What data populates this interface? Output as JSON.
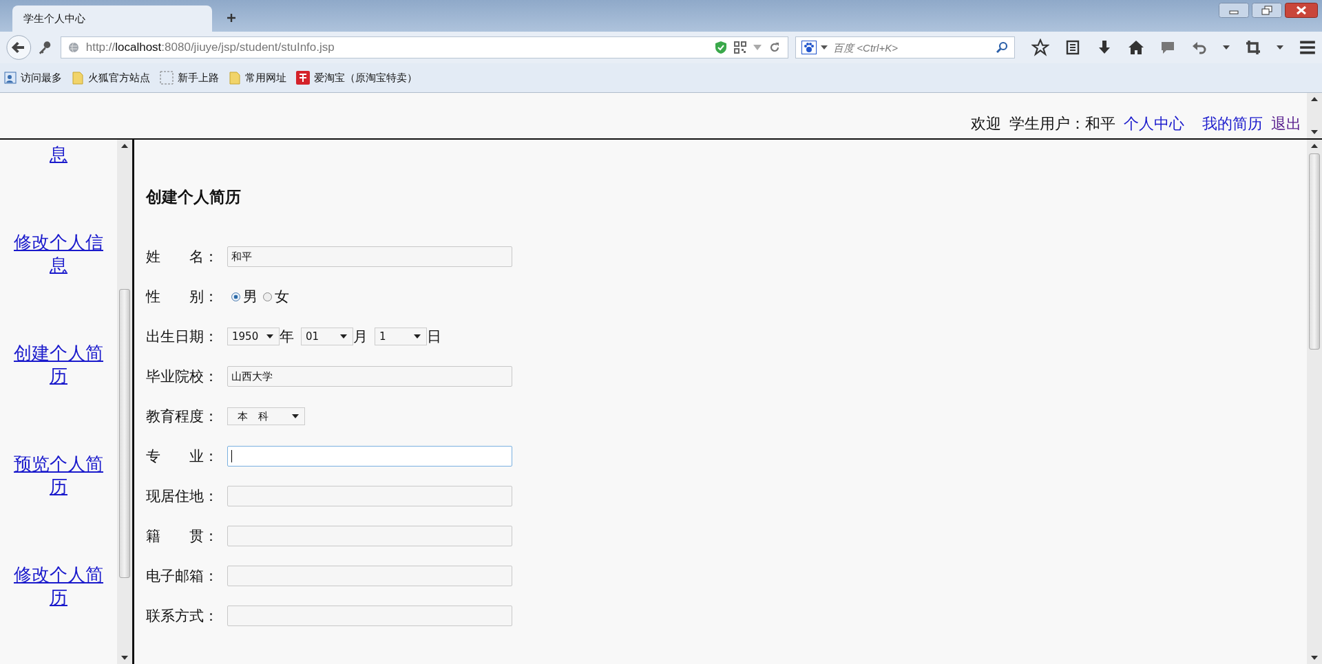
{
  "browser": {
    "tab": {
      "title": "学生个人中心",
      "selected": true
    },
    "url": {
      "scheme": "http://",
      "host": "localhost",
      "rest": ":8080/jiuye/jsp/student/stuInfo.jsp"
    },
    "search_placeholder": "百度 <Ctrl+K>",
    "bookmarks": [
      {
        "label": "访问最多",
        "kind": "smart"
      },
      {
        "label": "火狐官方站点",
        "kind": "folder"
      },
      {
        "label": "新手上路",
        "kind": "page"
      },
      {
        "label": "常用网址",
        "kind": "folder"
      },
      {
        "label": "爱淘宝（原淘宝特卖）",
        "kind": "shop"
      }
    ]
  },
  "header": {
    "welcome": "欢迎",
    "user": "学生用户：和平",
    "links": [
      {
        "label": "个人中心",
        "visited": false
      },
      {
        "label": "我的简历",
        "visited": false
      },
      {
        "label": "退出",
        "visited": true
      }
    ]
  },
  "sidebar": {
    "links": [
      "息",
      "修改个人信息",
      "创建个人简历",
      "预览个人简历",
      "修改个人简历"
    ]
  },
  "form": {
    "title": "创建个人简历",
    "fields": [
      {
        "kind": "text",
        "label": "姓　　名：",
        "value": "和平",
        "focused": false
      },
      {
        "kind": "radio",
        "label": "性　　别：",
        "options": [
          {
            "label": "男",
            "selected": true
          },
          {
            "label": "女",
            "selected": false
          }
        ]
      },
      {
        "kind": "date",
        "label": "出生日期：",
        "parts": [
          {
            "value": "1950",
            "unit": "年"
          },
          {
            "value": "01",
            "unit": "月"
          },
          {
            "value": "1",
            "unit": "日"
          }
        ]
      },
      {
        "kind": "text",
        "label": "毕业院校：",
        "value": "山西大学",
        "focused": false
      },
      {
        "kind": "select",
        "label": "教育程度：",
        "value": "本　科"
      },
      {
        "kind": "text",
        "label": "专　　业：",
        "focused": true
      },
      {
        "kind": "text",
        "label": "现居住地：",
        "focused": false
      },
      {
        "kind": "text",
        "label": "籍　　贯：",
        "focused": false
      },
      {
        "kind": "text",
        "label": "电子邮箱：",
        "focused": false
      },
      {
        "kind": "text",
        "label": "联系方式：",
        "focused": false
      }
    ]
  }
}
